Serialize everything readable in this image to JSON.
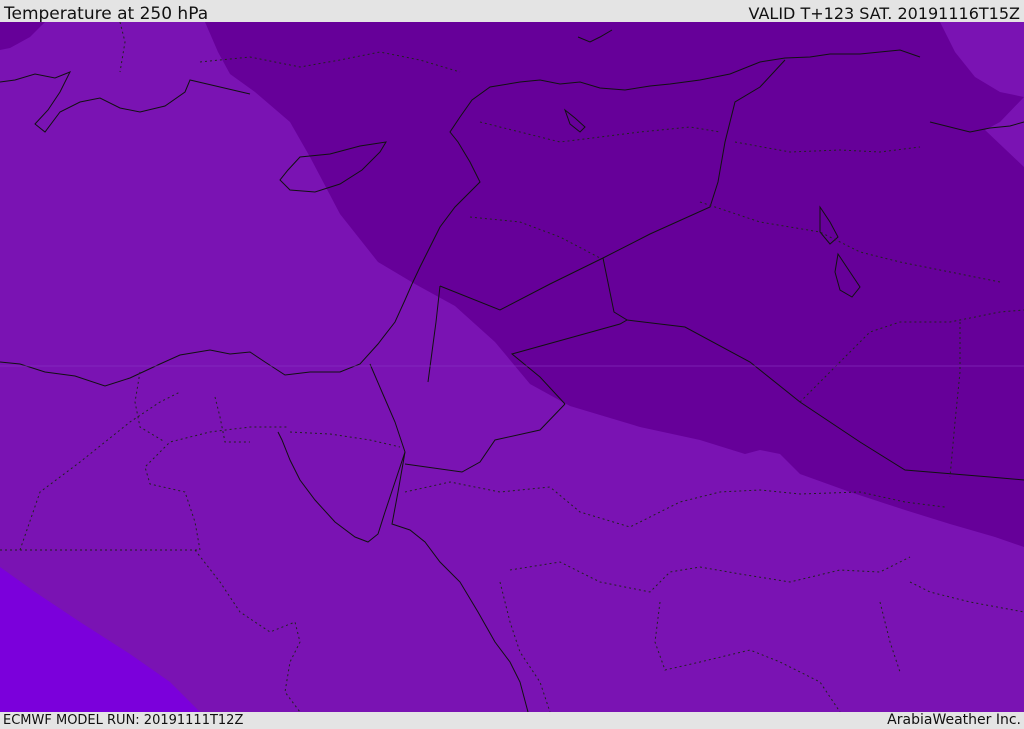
{
  "header": {
    "title": "Temperature at 250 hPa",
    "valid_time": "VALID T+123 SAT. 20191116T15Z"
  },
  "footer": {
    "model_run": "ECMWF MODEL RUN: 20191111T12Z",
    "credit": "ArabiaWeather Inc."
  },
  "map": {
    "fill_colors": {
      "warm_band_light": "#7a13b3",
      "cold_band_dark": "#660099",
      "warmest_band": "#7b00db"
    },
    "line_colors": {
      "coastline": "#111111",
      "border_dotted": "#222222"
    }
  }
}
